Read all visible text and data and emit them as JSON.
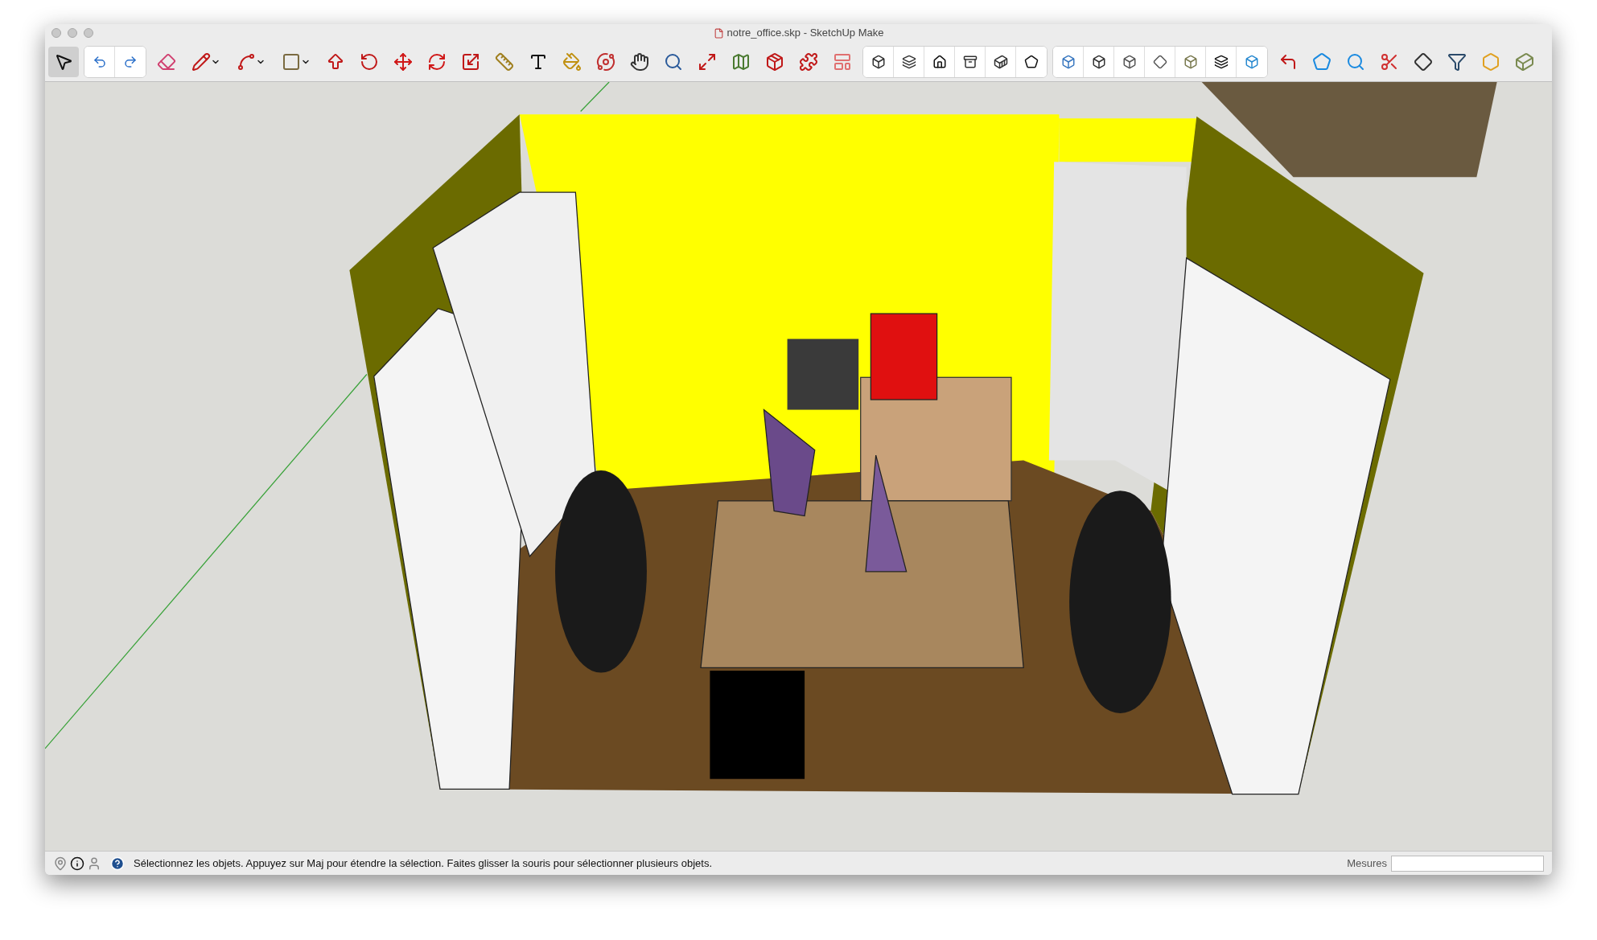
{
  "window": {
    "title": "notre_office.skp - SketchUp Make"
  },
  "toolbar": [
    {
      "segmented": false,
      "tools": [
        {
          "kind": "select",
          "selected": true
        }
      ]
    },
    {
      "segmented": true,
      "tools": [
        {
          "kind": "undo",
          "selected": false
        },
        {
          "kind": "redo",
          "selected": false
        }
      ]
    },
    {
      "segmented": false,
      "tools": [
        {
          "kind": "eraser",
          "selected": false
        },
        {
          "kind": "pencil",
          "selected": false,
          "dropdown": true
        },
        {
          "kind": "arc",
          "selected": false,
          "dropdown": true
        },
        {
          "kind": "rectangle",
          "selected": false,
          "dropdown": true
        },
        {
          "kind": "pushpull",
          "selected": false
        },
        {
          "kind": "followme",
          "selected": false
        },
        {
          "kind": "move",
          "selected": false
        },
        {
          "kind": "rotate",
          "selected": false
        },
        {
          "kind": "scale",
          "selected": false
        },
        {
          "kind": "tape",
          "selected": false
        },
        {
          "kind": "text",
          "selected": false
        },
        {
          "kind": "paint",
          "selected": false
        },
        {
          "kind": "orbit",
          "selected": false
        },
        {
          "kind": "pan",
          "selected": false
        },
        {
          "kind": "zoom",
          "selected": false
        },
        {
          "kind": "zoomextents",
          "selected": false
        },
        {
          "kind": "map",
          "selected": false
        },
        {
          "kind": "warehouse",
          "selected": false
        },
        {
          "kind": "extension",
          "selected": false
        },
        {
          "kind": "layout",
          "selected": false
        }
      ]
    },
    {
      "segmented": true,
      "tools": [
        {
          "kind": "iso",
          "selected": false
        },
        {
          "kind": "top",
          "selected": false
        },
        {
          "kind": "front",
          "selected": false
        },
        {
          "kind": "right",
          "selected": false
        },
        {
          "kind": "back",
          "selected": false
        },
        {
          "kind": "left",
          "selected": false
        }
      ]
    },
    {
      "segmented": true,
      "tools": [
        {
          "kind": "xray",
          "selected": false
        },
        {
          "kind": "backedges",
          "selected": false
        },
        {
          "kind": "wireframe",
          "selected": false
        },
        {
          "kind": "hidden",
          "selected": false
        },
        {
          "kind": "shaded",
          "selected": false
        },
        {
          "kind": "monochrome",
          "selected": false
        },
        {
          "kind": "textured",
          "selected": false
        }
      ]
    },
    {
      "segmented": false,
      "tools": [
        {
          "kind": "fillet",
          "selected": false
        },
        {
          "kind": "roof",
          "selected": false
        },
        {
          "kind": "roofsearch",
          "selected": false
        },
        {
          "kind": "section",
          "selected": false
        },
        {
          "kind": "sectionplane",
          "selected": false
        },
        {
          "kind": "funnel",
          "selected": false
        },
        {
          "kind": "solid",
          "selected": false
        },
        {
          "kind": "solidsplit",
          "selected": false
        }
      ]
    }
  ],
  "status_bar": {
    "message": "Sélectionnez les objets. Appuyez sur Maj pour étendre la sélection. Faites glisser la souris pour sélectionner plusieurs objets.",
    "measure_label": "Mesures"
  }
}
